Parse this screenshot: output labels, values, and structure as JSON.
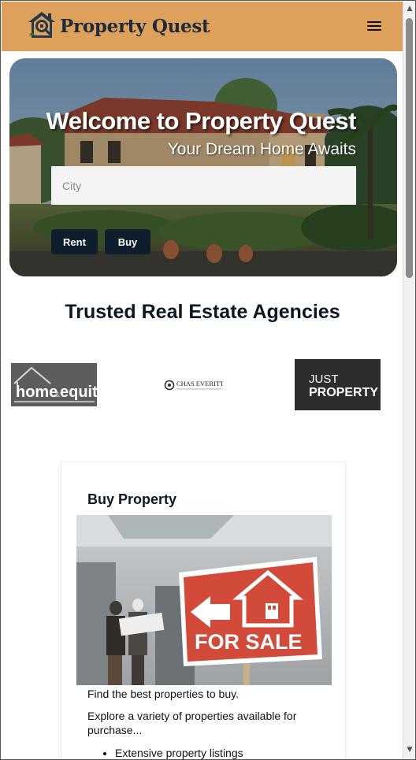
{
  "header": {
    "brand": "Property Quest",
    "logo_icon": "house-magnifier-logo-icon",
    "menu_icon": "hamburger-menu-icon",
    "colors": {
      "background": "#dea15b",
      "brand_text": "#1f2b3a"
    }
  },
  "hero": {
    "title": "Welcome to Property Quest",
    "subtitle": "Your Dream Home Awaits",
    "search": {
      "placeholder": "City",
      "value": ""
    },
    "rent_label": "Rent",
    "buy_label": "Buy",
    "button_color": "#0f1e2c"
  },
  "agencies": {
    "title": "Trusted Real Estate Agencies",
    "logos": [
      {
        "name": "home & equity",
        "text_main": "home",
        "text_amp": "&",
        "text_second": "equity"
      },
      {
        "name": "CHAS EVERITT",
        "text_main": "CHAS EVERITT"
      },
      {
        "name": "JUST PROPERTY",
        "text_main": "JUST",
        "text_second": "PROPERTY"
      }
    ]
  },
  "card": {
    "title": "Buy Property",
    "sign_text": "FOR SALE",
    "desc1": "Find the best properties to buy.",
    "desc2": "Explore a variety of properties available for purchase...",
    "features": [
      "Extensive property listings"
    ]
  },
  "scrollbar": {
    "up_icon": "scroll-up-arrow-icon",
    "down_icon": "scroll-down-arrow-icon"
  }
}
